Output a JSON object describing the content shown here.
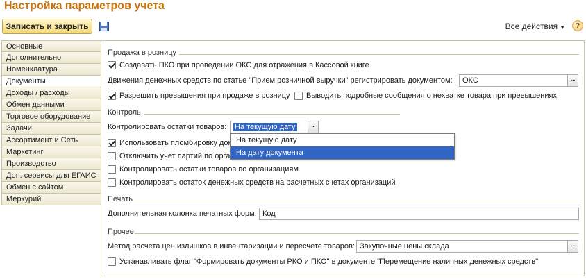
{
  "title": "Настройка параметров учета",
  "toolbar": {
    "save_close_label": "Записать и закрыть",
    "all_actions_label": "Все действия",
    "help_label": "?"
  },
  "sidebar": {
    "items": [
      {
        "label": "Основные"
      },
      {
        "label": "Дополнительно"
      },
      {
        "label": "Номенклатура"
      },
      {
        "label": "Документы"
      },
      {
        "label": "Доходы / расходы"
      },
      {
        "label": "Обмен данными"
      },
      {
        "label": "Торговое оборудование"
      },
      {
        "label": "Задачи"
      },
      {
        "label": "Ассортимент и Сеть"
      },
      {
        "label": "Маркетинг"
      },
      {
        "label": "Производство"
      },
      {
        "label": "Доп. сервисы для ЕГАИС"
      },
      {
        "label": "Обмен с сайтом"
      },
      {
        "label": "Меркурий"
      }
    ],
    "active_index": 3
  },
  "retail": {
    "title": "Продажа в розницу",
    "create_pko": {
      "label": "Создавать ПКО при проведении ОКС для отражения в Кассовой книге",
      "checked": true
    },
    "cash_flow_label": "Движения денежных средств по статье \"Прием розничной выручки\" регистрировать документом:",
    "cash_flow_value": "ОКС",
    "allow_excess": {
      "label": "Разрешить превышения при продаже в розницу",
      "checked": true
    },
    "detailed_msgs": {
      "label": "Выводить подробные сообщения о нехватке товара при превышениях",
      "checked": false
    }
  },
  "control": {
    "title": "Контроль",
    "stock_control_label": "Контролировать остатки товаров:",
    "stock_control_value": "На текущую дату",
    "use_seal": {
      "label": "Использовать пломбировку док",
      "checked": true
    },
    "disable_batches": {
      "label": "Отключить учет партий по орган",
      "checked": false
    },
    "control_by_org": {
      "label": "Контролировать остатки товаров по организациям",
      "checked": false
    },
    "control_cash": {
      "label": "Контролировать остаток денежных средств на расчетных счетах организаций",
      "checked": false
    },
    "dropdown_options": [
      "На текущую дату",
      "На дату документа"
    ],
    "dropdown_highlighted": 1
  },
  "print": {
    "title": "Печать",
    "extra_column_label": "Дополнительная колонка печатных форм:",
    "extra_column_value": "Код"
  },
  "other": {
    "title": "Прочее",
    "price_method_label": "Метод расчета цен излишков в инвентаризации и пересчете товаров:",
    "price_method_value": "Закупочные цены склада",
    "set_flag": {
      "label": "Устанавливать флаг \"Формировать документы РКО и ПКО\" в документе \"Перемещение наличных денежных средств\"",
      "checked": false
    }
  }
}
